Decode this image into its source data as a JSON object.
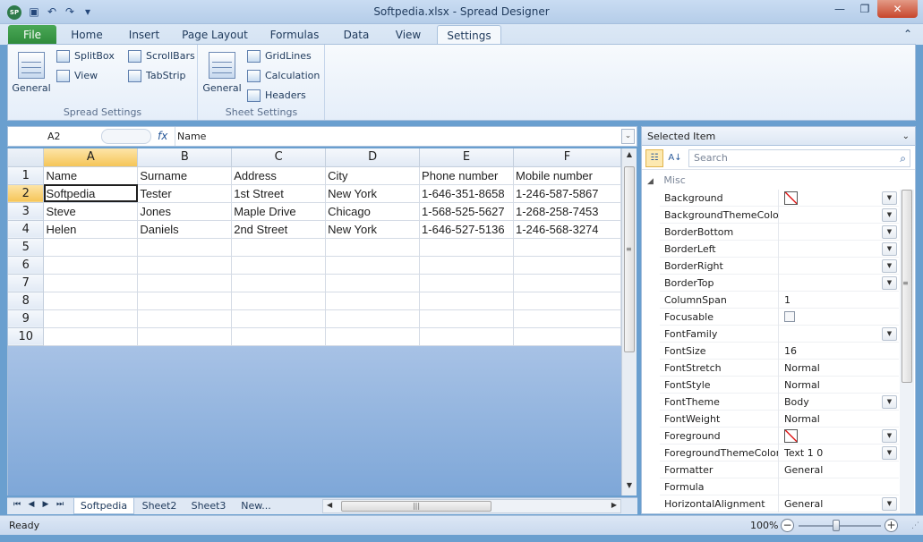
{
  "window": {
    "title": "Softpedia.xlsx - Spread Designer",
    "app_icon_text": "SP",
    "qat": [
      "save-icon",
      "undo-icon",
      "redo-icon",
      "customize-icon"
    ],
    "controls": [
      "minimize-icon",
      "restore-icon",
      "close-icon"
    ]
  },
  "ribbon": {
    "file_tab": "File",
    "tabs": [
      "Home",
      "Insert",
      "Page Layout",
      "Formulas",
      "Data",
      "View",
      "Settings"
    ],
    "active_tab": "Settings",
    "groups": {
      "spread": {
        "label": "Spread Settings",
        "general": "General",
        "splitbox": "SplitBox",
        "view": "View",
        "scrollbars": "ScrollBars",
        "tabstrip": "TabStrip"
      },
      "sheet": {
        "label": "Sheet Settings",
        "general": "General",
        "gridlines": "GridLines",
        "calculation": "Calculation",
        "headers": "Headers"
      }
    }
  },
  "formula_bar": {
    "cell_ref": "A2",
    "fx": "fx",
    "formula": "Name"
  },
  "sheet": {
    "columns": [
      "A",
      "B",
      "C",
      "D",
      "E",
      "F"
    ],
    "rows": [
      {
        "num": "1",
        "cells": [
          "Name",
          "Surname",
          "Address",
          "City",
          "Phone number",
          "Mobile number"
        ]
      },
      {
        "num": "2",
        "cells": [
          "Softpedia",
          "Tester",
          "1st Street",
          "New York",
          "1-646-351-8658",
          "1-246-587-5867"
        ]
      },
      {
        "num": "3",
        "cells": [
          "Steve",
          "Jones",
          "Maple Drive",
          "Chicago",
          "1-568-525-5627",
          "1-268-258-7453"
        ]
      },
      {
        "num": "4",
        "cells": [
          "Helen",
          "Daniels",
          "2nd Street",
          "New York",
          "1-646-527-5136",
          "1-246-568-3274"
        ]
      },
      {
        "num": "5",
        "cells": [
          "",
          "",
          "",
          "",
          "",
          ""
        ]
      },
      {
        "num": "6",
        "cells": [
          "",
          "",
          "",
          "",
          "",
          ""
        ]
      },
      {
        "num": "7",
        "cells": [
          "",
          "",
          "",
          "",
          "",
          ""
        ]
      },
      {
        "num": "8",
        "cells": [
          "",
          "",
          "",
          "",
          "",
          ""
        ]
      },
      {
        "num": "9",
        "cells": [
          "",
          "",
          "",
          "",
          "",
          ""
        ]
      },
      {
        "num": "10",
        "cells": [
          "",
          "",
          "",
          "",
          "",
          ""
        ]
      }
    ],
    "selected_cell": "A2",
    "tabs": [
      "Softpedia",
      "Sheet2",
      "Sheet3",
      "New..."
    ],
    "active_tab": "Softpedia"
  },
  "properties": {
    "header": "Selected Item",
    "search_placeholder": "Search",
    "category": "Misc",
    "items": [
      {
        "name": "Background",
        "value": "",
        "type": "color",
        "dropdown": true
      },
      {
        "name": "BackgroundThemeColor",
        "value": "",
        "type": "text",
        "dropdown": true
      },
      {
        "name": "BorderBottom",
        "value": "",
        "type": "text",
        "dropdown": true
      },
      {
        "name": "BorderLeft",
        "value": "",
        "type": "text",
        "dropdown": true
      },
      {
        "name": "BorderRight",
        "value": "",
        "type": "text",
        "dropdown": true
      },
      {
        "name": "BorderTop",
        "value": "",
        "type": "text",
        "dropdown": true
      },
      {
        "name": "ColumnSpan",
        "value": "1",
        "type": "text",
        "dropdown": false
      },
      {
        "name": "Focusable",
        "value": "",
        "type": "checkbox",
        "dropdown": false
      },
      {
        "name": "FontFamily",
        "value": "",
        "type": "text",
        "dropdown": true
      },
      {
        "name": "FontSize",
        "value": "16",
        "type": "text",
        "dropdown": false
      },
      {
        "name": "FontStretch",
        "value": "Normal",
        "type": "text",
        "dropdown": false
      },
      {
        "name": "FontStyle",
        "value": "Normal",
        "type": "text",
        "dropdown": false
      },
      {
        "name": "FontTheme",
        "value": "Body",
        "type": "text",
        "dropdown": true
      },
      {
        "name": "FontWeight",
        "value": "Normal",
        "type": "text",
        "dropdown": false
      },
      {
        "name": "Foreground",
        "value": "",
        "type": "color",
        "dropdown": true
      },
      {
        "name": "ForegroundThemeColor",
        "value": "Text 1 0",
        "type": "text",
        "dropdown": true
      },
      {
        "name": "Formatter",
        "value": "General",
        "type": "text",
        "dropdown": false
      },
      {
        "name": "Formula",
        "value": "",
        "type": "text",
        "dropdown": false
      },
      {
        "name": "HorizontalAlignment",
        "value": "General",
        "type": "text",
        "dropdown": true
      }
    ]
  },
  "status": {
    "text": "Ready",
    "zoom": "100%"
  }
}
